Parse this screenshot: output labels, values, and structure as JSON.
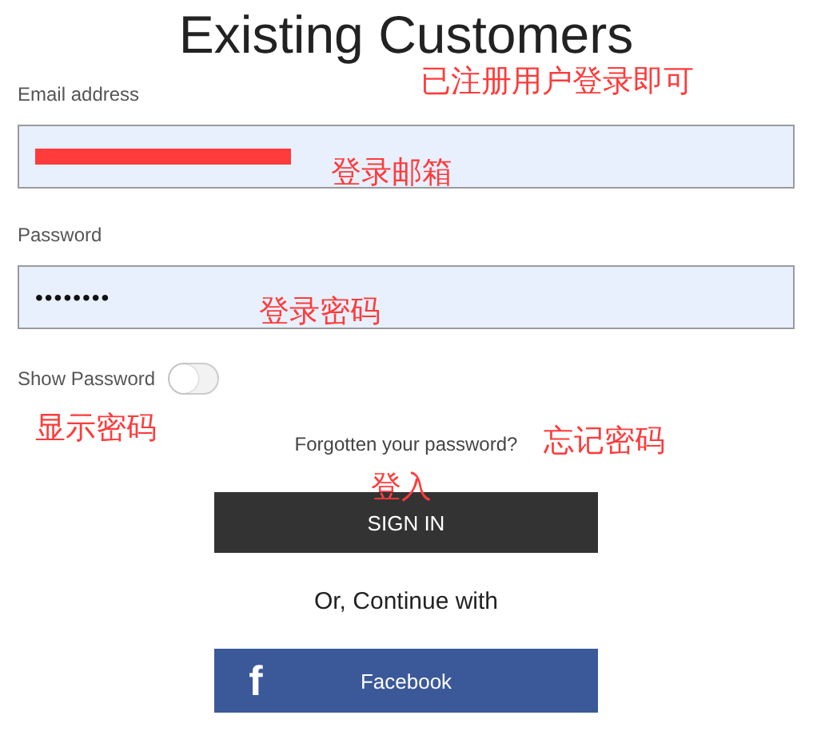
{
  "title": "Existing Customers",
  "email": {
    "label": "Email address",
    "redacted": true
  },
  "password": {
    "label": "Password",
    "value": "••••••••"
  },
  "show_password": {
    "label": "Show Password",
    "on": false
  },
  "forgot_link": "Forgotten your password?",
  "sign_in": "SIGN IN",
  "divider_text": "Or, Continue with",
  "facebook": {
    "icon": "f",
    "label": "Facebook"
  },
  "annotations": [
    "已注册用户登录即可",
    "登录邮箱",
    "登录密码",
    "显示密码",
    "忘记密码",
    "登入"
  ]
}
